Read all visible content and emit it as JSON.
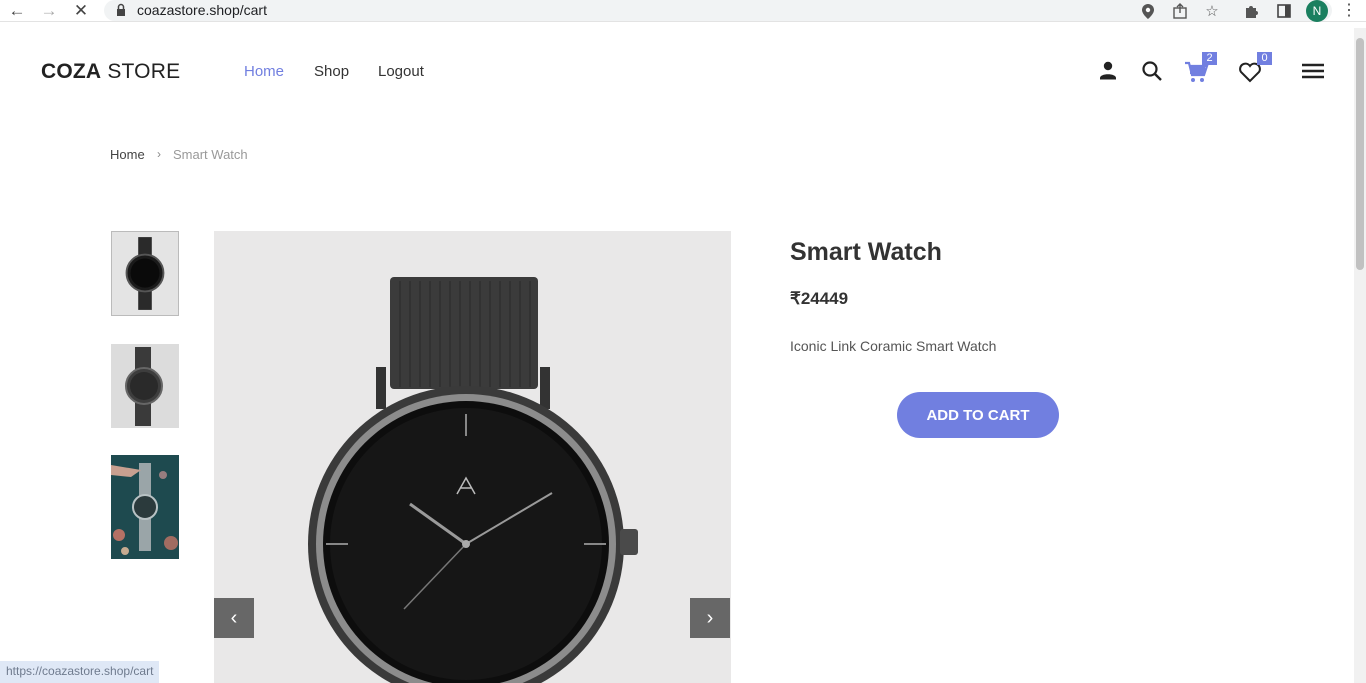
{
  "browser": {
    "url": "coazastore.shop/cart",
    "profile_initial": "N",
    "status_link": "https://coazastore.shop/cart"
  },
  "header": {
    "logo_bold": "COZA",
    "logo_rest": " STORE",
    "menu": [
      "Home",
      "Shop",
      "Logout"
    ],
    "cart_count": "2",
    "wishlist_count": "0"
  },
  "breadcrumb": {
    "home": "Home",
    "separator": "›",
    "current": "Smart Watch"
  },
  "product": {
    "title": "Smart Watch",
    "price": "₹24449",
    "description": "Iconic Link Coramic Smart Watch",
    "add_to_cart": "ADD TO CART"
  },
  "colors": {
    "accent": "#717fe0"
  }
}
